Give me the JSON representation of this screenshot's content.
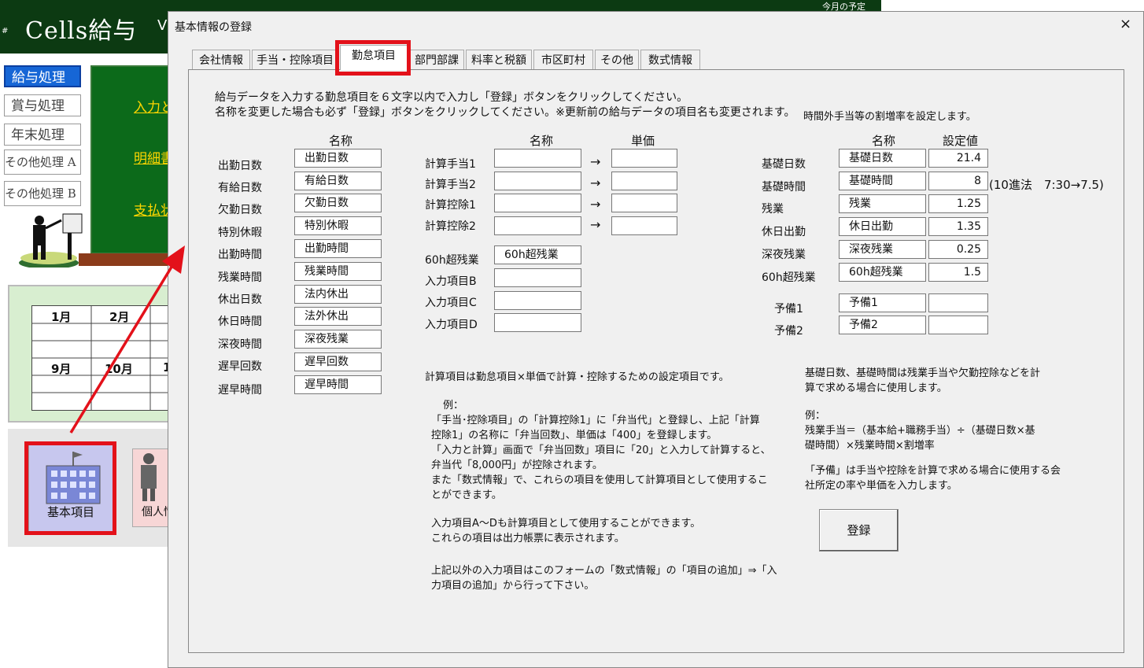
{
  "background": {
    "app_title": "Cells給与",
    "app_title_suffix": "V",
    "header_small": "今月の予定",
    "hash_mark": "#",
    "menu": [
      "給与処理",
      "賞与処理",
      "年末処理",
      "その他処理 A",
      "その他処理 B"
    ],
    "board_links": [
      "入力と",
      "明細書",
      "支払状"
    ],
    "calendar_months": [
      "1月",
      "2月",
      "9月",
      "10月",
      "1"
    ],
    "icons": {
      "kihon_label": "基本項目",
      "kojin_label": "個人情"
    }
  },
  "dialog": {
    "title": "基本情報の登録",
    "close": "×",
    "tabs": [
      "会社情報",
      "手当・控除項目",
      "勤怠項目",
      "部門部課",
      "料率と税額",
      "市区町村",
      "その他",
      "数式情報"
    ],
    "active_tab": "勤怠項目",
    "instruction_lines": [
      "給与データを入力する勤怠項目を６文字以内で入力し「登録」ボタンをクリックしてください。",
      "名称を変更した場合も必ず「登録」ボタンをクリックしてください。※更新前の給与データの項目名も変更されます。"
    ],
    "attendance": {
      "header": "名称",
      "rows": [
        {
          "label": "出勤日数",
          "value": "出勤日数"
        },
        {
          "label": "有給日数",
          "value": "有給日数"
        },
        {
          "label": "欠勤日数",
          "value": "欠勤日数"
        },
        {
          "label": "特別休暇",
          "value": "特別休暇"
        },
        {
          "label": "出勤時間",
          "value": "出勤時間"
        },
        {
          "label": "残業時間",
          "value": "残業時間"
        },
        {
          "label": "休出日数",
          "value": "法内休出"
        },
        {
          "label": "休日時間",
          "value": "法外休出"
        },
        {
          "label": "深夜時間",
          "value": "深夜残業"
        },
        {
          "label": "遅早回数",
          "value": "遅早回数"
        },
        {
          "label": "遅早時間",
          "value": "遅早時間"
        }
      ]
    },
    "calc": {
      "header_name": "名称",
      "header_price": "単価",
      "arrow": "→",
      "rows": [
        {
          "label": "計算手当1",
          "name": "",
          "price": ""
        },
        {
          "label": "計算手当2",
          "name": "",
          "price": ""
        },
        {
          "label": "計算控除1",
          "name": "",
          "price": ""
        },
        {
          "label": "計算控除2",
          "name": "",
          "price": ""
        }
      ],
      "inputs": [
        {
          "label": "60h超残業",
          "value": "60h超残業"
        },
        {
          "label": "入力項目B",
          "value": ""
        },
        {
          "label": "入力項目C",
          "value": ""
        },
        {
          "label": "入力項目D",
          "value": ""
        }
      ]
    },
    "rate": {
      "caption": "時間外手当等の割増率を設定します。",
      "header_name": "名称",
      "header_value": "設定値",
      "rows": [
        {
          "label": "基礎日数",
          "name": "基礎日数",
          "value": "21.4"
        },
        {
          "label": "基礎時間",
          "name": "基礎時間",
          "value": "8"
        },
        {
          "label": "残業",
          "name": "残業",
          "value": "1.25"
        },
        {
          "label": "休日出勤",
          "name": "休日出勤",
          "value": "1.35"
        },
        {
          "label": "深夜残業",
          "name": "深夜残業",
          "value": "0.25"
        },
        {
          "label": "60h超残業",
          "name": "60h超残業",
          "value": "1.5"
        }
      ],
      "note_time": "(10進法　7:30→7.5)",
      "spares": [
        {
          "label": "予備1",
          "name": "予備1",
          "value": ""
        },
        {
          "label": "予備2",
          "name": "予備2",
          "value": ""
        }
      ]
    },
    "explain_calc": [
      "計算項目は勤怠項目×単価で計算・控除するための設定項目です。",
      "例：",
      "「手当･控除項目」の「計算控除1」に「弁当代」と登録し、上記「計算",
      "控除1」の名称に「弁当回数」、単価は「400」を登録します。",
      "「入力と計算」画面で「弁当回数」項目に「20」と入力して計算すると、",
      "弁当代「8,000円」が控除されます。",
      "また「数式情報」で、これらの項目を使用して計算項目として使用するこ",
      "とができます。",
      "入力項目A～Dも計算項目として使用することができます。",
      "これらの項目は出力帳票に表示されます。",
      "上記以外の入力項目はこのフォームの「数式情報」の「項目の追加」⇒「入",
      "力項目の追加」から行って下さい。"
    ],
    "explain_rate": [
      "基礎日数、基礎時間は残業手当や欠勤控除などを計",
      "算で求める場合に使用します。",
      "例：",
      "残業手当＝（基本給+職務手当）÷（基礎日数×基",
      "礎時間）×残業時間×割増率",
      "「予備」は手当や控除を計算で求める場合に使用する会",
      "社所定の率や単価を入力します。"
    ],
    "register_button": "登録"
  },
  "colors": {
    "highlight": "#e3111a",
    "board": "#0c6a1a",
    "header": "#0c3a12",
    "selected_menu": "#1666d6"
  }
}
